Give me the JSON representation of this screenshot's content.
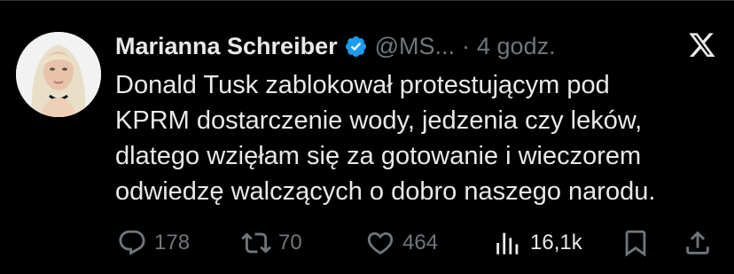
{
  "tweet": {
    "author_name": "Marianna Schreiber",
    "handle": "@MS...",
    "separator": "·",
    "time": "4 godz.",
    "verified": true,
    "text_lines": [
      "Donald Tusk zablokował protestującym pod",
      "KPRM dostarczenie wody, jedzenia czy leków,",
      "dlatego wzięłam się za gotowanie i wieczorem",
      "odwiedzę walczących o dobro naszego narodu."
    ]
  },
  "actions": {
    "replies": "178",
    "reposts": "70",
    "likes": "464",
    "views": "16,1k"
  },
  "icons": {
    "verified": "verified-badge-icon",
    "brand": "x-logo-icon",
    "reply": "reply-icon",
    "repost": "repost-icon",
    "like": "heart-icon",
    "views": "views-icon",
    "bookmark": "bookmark-icon",
    "share": "share-icon"
  },
  "colors": {
    "background": "#000000",
    "text_primary": "#e7e9ea",
    "text_secondary": "#71767b",
    "verified_blue": "#1d9bf0"
  }
}
